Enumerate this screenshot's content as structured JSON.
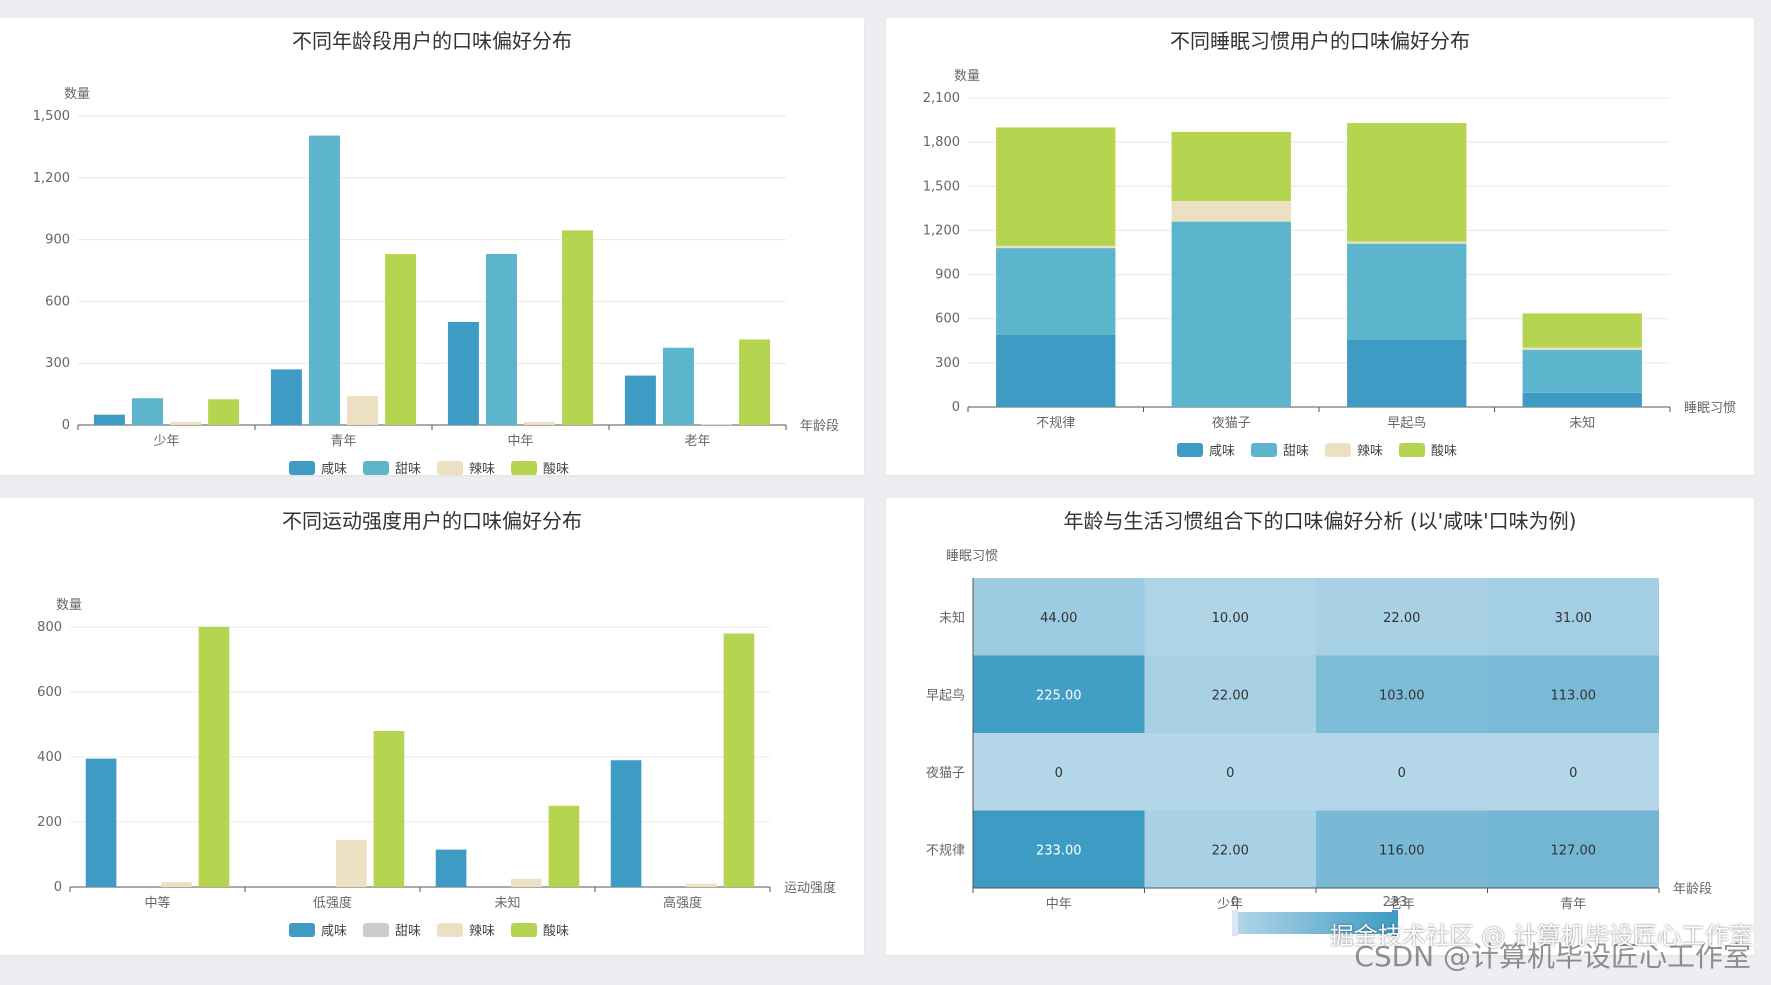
{
  "colors": {
    "salty": "#3e9cc4",
    "sweet": "#5db5cd",
    "spicy": "#eddfc2",
    "sour": "#b5d551",
    "legend_disabled": "#cccccc",
    "heat_low": "#b3d6e8",
    "heat_high": "#3e9cc4"
  },
  "chart_data": [
    {
      "id": "age",
      "type": "bar",
      "title": "不同年龄段用户的口味偏好分布",
      "ylabel": "数量",
      "xlabel": "年龄段",
      "ylim": [
        0,
        1500
      ],
      "yticks": [
        "0",
        "300",
        "600",
        "900",
        "1,200",
        "1,500"
      ],
      "ytick_values": [
        0,
        300,
        600,
        900,
        1200,
        1500
      ],
      "categories": [
        "少年",
        "青年",
        "中年",
        "老年"
      ],
      "series": [
        {
          "name": "咸味",
          "color_key": "salty",
          "values": [
            50,
            270,
            500,
            240
          ]
        },
        {
          "name": "甜味",
          "color_key": "sweet",
          "values": [
            130,
            1405,
            830,
            375
          ]
        },
        {
          "name": "辣味",
          "color_key": "spicy",
          "values": [
            15,
            140,
            15,
            5
          ]
        },
        {
          "name": "酸味",
          "color_key": "sour",
          "values": [
            125,
            830,
            945,
            415
          ]
        }
      ],
      "legend": [
        "咸味",
        "甜味",
        "辣味",
        "酸味"
      ],
      "legend_position": "bottom-center",
      "grid": true
    },
    {
      "id": "sleep",
      "type": "bar",
      "stacked": true,
      "title": "不同睡眠习惯用户的口味偏好分布",
      "ylabel": "数量",
      "xlabel": "睡眠习惯",
      "ylim": [
        0,
        2100
      ],
      "yticks": [
        "0",
        "300",
        "600",
        "900",
        "1,200",
        "1,500",
        "1,800",
        "2,100"
      ],
      "ytick_values": [
        0,
        300,
        600,
        900,
        1200,
        1500,
        1800,
        2100
      ],
      "categories": [
        "不规律",
        "夜猫子",
        "早起鸟",
        "未知"
      ],
      "series": [
        {
          "name": "咸味",
          "color_key": "salty",
          "values": [
            490,
            0,
            460,
            97
          ]
        },
        {
          "name": "甜味",
          "color_key": "sweet",
          "values": [
            590,
            1260,
            650,
            292
          ]
        },
        {
          "name": "辣味",
          "color_key": "spicy",
          "values": [
            15,
            140,
            15,
            15
          ]
        },
        {
          "name": "酸味",
          "color_key": "sour",
          "values": [
            805,
            470,
            805,
            232
          ]
        }
      ],
      "legend": [
        "咸味",
        "甜味",
        "辣味",
        "酸味"
      ],
      "legend_position": "bottom-center",
      "grid": true
    },
    {
      "id": "exercise",
      "type": "bar",
      "title": "不同运动强度用户的口味偏好分布",
      "ylabel": "数量",
      "xlabel": "运动强度",
      "ylim": [
        0,
        800
      ],
      "yticks": [
        "0",
        "200",
        "400",
        "600",
        "800"
      ],
      "ytick_values": [
        0,
        200,
        400,
        600,
        800
      ],
      "categories": [
        "中等",
        "低强度",
        "未知",
        "高强度"
      ],
      "series": [
        {
          "name": "咸味",
          "color_key": "salty",
          "values": [
            395,
            0,
            115,
            390
          ]
        },
        {
          "name": "甜味",
          "color_key": "sweet",
          "values": [
            0,
            0,
            0,
            0
          ],
          "hidden": true
        },
        {
          "name": "辣味",
          "color_key": "spicy",
          "values": [
            15,
            145,
            25,
            10
          ]
        },
        {
          "name": "酸味",
          "color_key": "sour",
          "values": [
            800,
            480,
            250,
            780
          ]
        }
      ],
      "legend": [
        "咸味",
        "甜味",
        "辣味",
        "酸味"
      ],
      "legend_position": "bottom-center",
      "grid": true
    },
    {
      "id": "heatmap",
      "type": "heatmap",
      "title": "年龄与生活习惯组合下的口味偏好分析 (以'咸味'口味为例)",
      "ylabel": "睡眠习惯",
      "xlabel": "年龄段",
      "x_categories": [
        "中年",
        "少年",
        "老年",
        "青年"
      ],
      "y_categories": [
        "未知",
        "早起鸟",
        "夜猫子",
        "不规律"
      ],
      "values": [
        [
          44,
          10,
          22,
          31
        ],
        [
          225,
          22,
          103,
          113
        ],
        [
          0,
          0,
          0,
          0
        ],
        [
          233,
          22,
          116,
          127
        ]
      ],
      "labels": [
        [
          "44.00",
          "10.00",
          "22.00",
          "31.00"
        ],
        [
          "225.00",
          "22.00",
          "103.00",
          "113.00"
        ],
        [
          "0",
          "0",
          "0",
          "0"
        ],
        [
          "233.00",
          "22.00",
          "116.00",
          "127.00"
        ]
      ],
      "visual_map": {
        "min_label": "0",
        "max_label": "233",
        "min": 0,
        "max": 233
      }
    }
  ],
  "watermark": {
    "line1": "掘金技术社区 @ 计算机毕设匠心工作室",
    "line2": "CSDN @计算机毕设匠心工作室"
  }
}
